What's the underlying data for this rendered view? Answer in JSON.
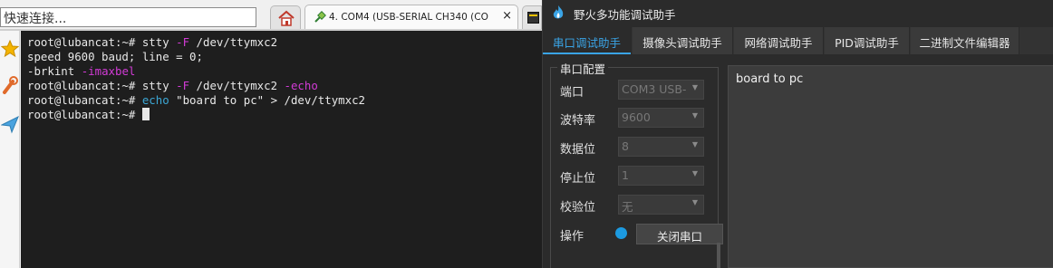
{
  "terminal_app": {
    "quick_connect_text": "快速连接...",
    "tabs": [
      {
        "icon": "home-icon"
      },
      {
        "icon": "serial-plug-icon",
        "label": "4. COM4  (USB-SERIAL CH340 (CO",
        "close": "×"
      },
      {
        "icon": "terminal-tab-icon"
      }
    ],
    "rail_icons": [
      "star-icon",
      "tools-icon",
      "paper-plane-icon"
    ],
    "lines": [
      {
        "prompt": "root@lubancat:~# ",
        "cmd": "stty ",
        "flag": "-F",
        "rest": " /dev/ttymxc2"
      },
      {
        "text": "speed 9600 baud; line = 0;"
      },
      {
        "text": "-brkint ",
        "flag": "-imaxbel"
      },
      {
        "prompt": "root@lubancat:~# ",
        "cmd": "stty ",
        "flag": "-F",
        "rest": " /dev/ttymxc2 ",
        "flag2": "-echo"
      },
      {
        "prompt": "root@lubancat:~# ",
        "arg": "echo",
        "rest": " \"board to pc\" > /dev/ttymxc2"
      },
      {
        "prompt": "root@lubancat:~# "
      }
    ]
  },
  "assistant": {
    "title": "野火多功能调试助手",
    "tabs": [
      {
        "label": "串口调试助手",
        "active": true
      },
      {
        "label": "摄像头调试助手",
        "active": false
      },
      {
        "label": "网络调试助手",
        "active": false
      },
      {
        "label": "PID调试助手",
        "active": false
      },
      {
        "label": "二进制文件编辑器",
        "active": false
      }
    ],
    "config": {
      "title": "串口配置",
      "fields": [
        {
          "label": "端口",
          "value": "COM3 USB-"
        },
        {
          "label": "波特率",
          "value": "9600"
        },
        {
          "label": "数据位",
          "value": "8"
        },
        {
          "label": "停止位",
          "value": "1"
        },
        {
          "label": "校验位",
          "value": "无"
        }
      ],
      "operation_label": "操作",
      "close_button_label": "关闭串口",
      "status_color": "#1c9ae0"
    },
    "received_text": "board to pc"
  }
}
